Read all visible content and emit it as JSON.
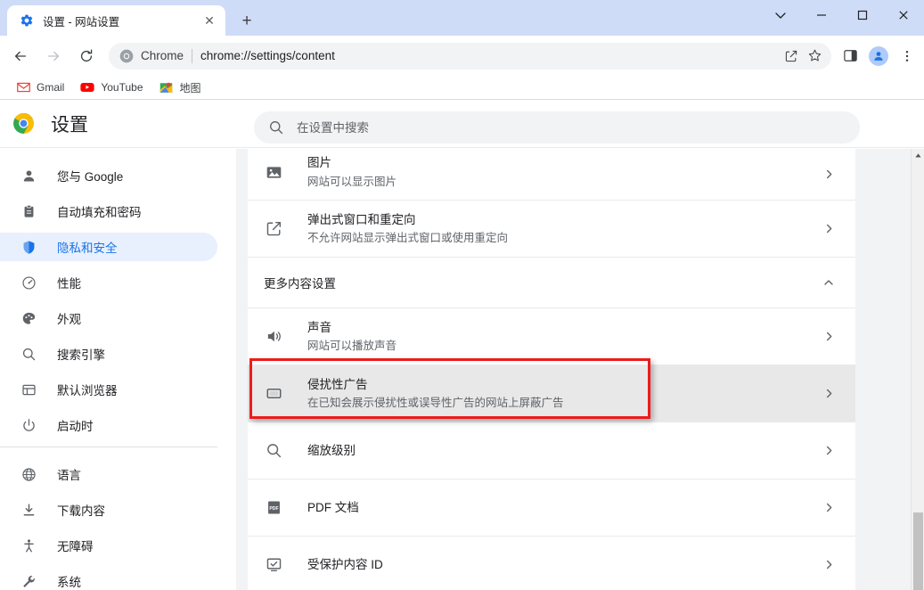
{
  "window": {
    "controls": [
      {
        "name": "tab-search-button",
        "glyph": "chevron-down"
      },
      {
        "name": "minimize-button",
        "glyph": "minimize"
      },
      {
        "name": "maximize-button",
        "glyph": "maximize"
      },
      {
        "name": "close-button",
        "glyph": "close"
      }
    ]
  },
  "tabstrip": {
    "tab": {
      "title": "设置 - 网站设置",
      "favicon": "gear-icon",
      "close_label": "✕"
    },
    "new_tab_label": "+"
  },
  "toolbar": {
    "back_label": "←",
    "forward_label": "→",
    "reload_label": "⟳",
    "omnibox": {
      "chip": "Chrome",
      "separator": "|",
      "url": "chrome://settings/content",
      "icons": [
        "share-icon",
        "bookmark-star-icon"
      ]
    },
    "right_icons": [
      "side-panel-icon",
      "profile-avatar",
      "three-dot-menu-icon"
    ]
  },
  "bookmarks": [
    {
      "label": "Gmail",
      "icon": "gmail-icon"
    },
    {
      "label": "YouTube",
      "icon": "youtube-icon"
    },
    {
      "label": "地图",
      "icon": "maps-icon"
    }
  ],
  "settings_header": {
    "logo": "chrome-logo",
    "title": "设置"
  },
  "search": {
    "placeholder": "在设置中搜索",
    "value": "",
    "icon": "search-icon"
  },
  "sidebar": {
    "items": [
      {
        "label": "您与 Google",
        "icon": "person-icon",
        "active": false
      },
      {
        "label": "自动填充和密码",
        "icon": "clipboard-icon",
        "active": false
      },
      {
        "label": "隐私和安全",
        "icon": "shield-icon",
        "active": true
      },
      {
        "label": "性能",
        "icon": "speedometer-icon",
        "active": false
      },
      {
        "label": "外观",
        "icon": "palette-icon",
        "active": false
      },
      {
        "label": "搜索引擎",
        "icon": "search-icon",
        "active": false
      },
      {
        "label": "默认浏览器",
        "icon": "browser-window-icon",
        "active": false
      },
      {
        "label": "启动时",
        "icon": "power-icon",
        "active": false
      }
    ],
    "items_bottom": [
      {
        "label": "语言",
        "icon": "globe-icon"
      },
      {
        "label": "下载内容",
        "icon": "download-icon"
      },
      {
        "label": "无障碍",
        "icon": "accessibility-icon"
      },
      {
        "label": "系统",
        "icon": "wrench-icon"
      }
    ]
  },
  "content": {
    "rows_top": [
      {
        "title": "图片",
        "subtitle": "网站可以显示图片",
        "icon": "image-icon",
        "chevron": "chevron-right",
        "highlighted": false
      },
      {
        "title": "弹出式窗口和重定向",
        "subtitle": "不允许网站显示弹出式窗口或使用重定向",
        "icon": "external-link-icon",
        "chevron": "chevron-right",
        "highlighted": false
      }
    ],
    "section": {
      "label": "更多内容设置",
      "chevron": "chevron-up",
      "expanded": true
    },
    "rows_more": [
      {
        "title": "声音",
        "subtitle": "网站可以播放声音",
        "icon": "speaker-icon",
        "chevron": "chevron-right",
        "highlighted": false
      },
      {
        "title": "侵扰性广告",
        "subtitle": "在已知会展示侵扰性或误导性广告的网站上屏蔽广告",
        "icon": "ad-window-icon",
        "chevron": "chevron-right",
        "highlighted": true
      },
      {
        "title": "缩放级别",
        "subtitle": "",
        "icon": "magnifier-icon",
        "chevron": "chevron-right",
        "highlighted": false
      },
      {
        "title": "PDF 文档",
        "subtitle": "",
        "icon": "pdf-icon",
        "chevron": "chevron-right",
        "highlighted": false
      },
      {
        "title": "受保护内容 ID",
        "subtitle": "",
        "icon": "protected-content-icon",
        "chevron": "chevron-right",
        "highlighted": false
      }
    ]
  },
  "annotation": {
    "type": "red-highlight-box",
    "target": "侵扰性广告",
    "color": "#ee1b1b"
  },
  "scrollbar": {
    "up_arrow": "▲",
    "thumb_position": "bottom"
  },
  "colors": {
    "accent": "#1a73e8",
    "active_pill": "#e8f0fe",
    "page_bg": "#f1f3f4",
    "highlight_row": "#e8e8e8",
    "annotation": "#ee1b1b",
    "tabstrip": "#cfdcf7"
  }
}
